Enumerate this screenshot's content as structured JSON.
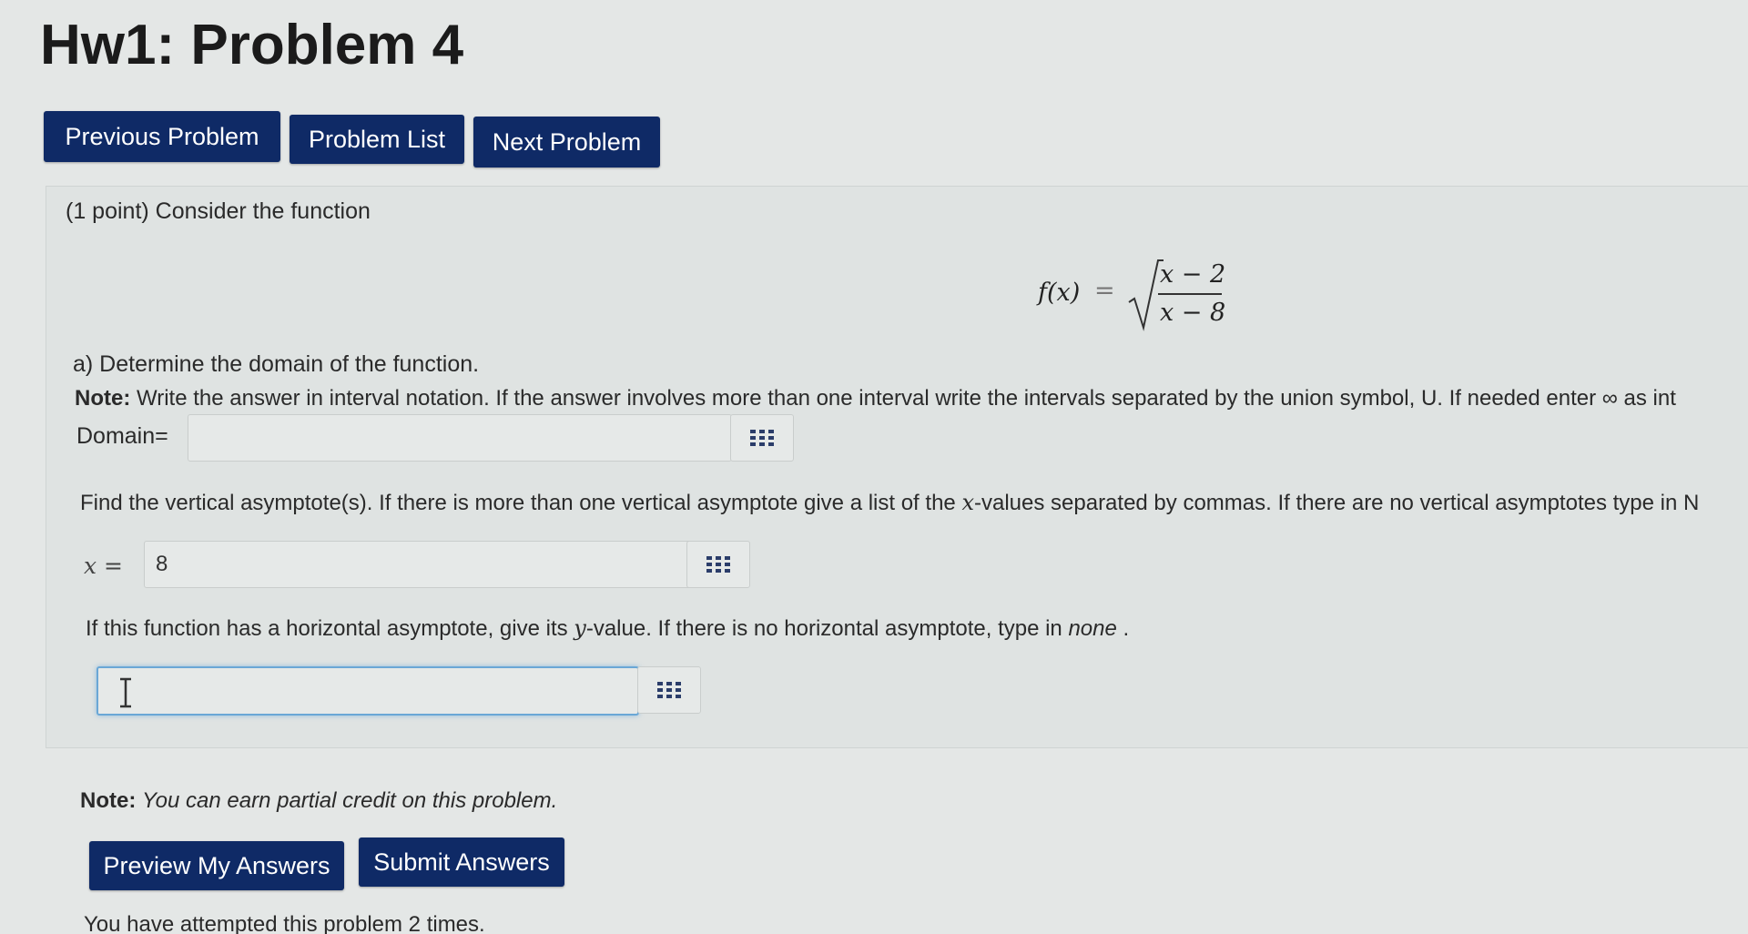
{
  "page": {
    "title": "Hw1: Problem 4"
  },
  "nav": {
    "previous": "Previous Problem",
    "list": "Problem List",
    "next": "Next Problem"
  },
  "problem": {
    "intro": "(1 point) Consider the function",
    "formula": {
      "lhs": "f(x)",
      "eq": "=",
      "numerator": "x − 2",
      "denominator": "x − 8"
    },
    "part_a": "a) Determine the domain of the function.",
    "note_label": "Note:",
    "note_text": " Write the answer in interval notation. If the answer involves more than one interval write the intervals separated by the union symbol, U. If needed enter ∞ as int",
    "domain_label": "Domain=",
    "domain_value": "",
    "vertical_text_1": "Find the vertical asymptote(s). If there is more than one vertical asymptote give a list of the ",
    "vertical_var": "x",
    "vertical_text_2": "-values separated by commas. If there are no vertical asymptotes type in N",
    "x_label": "x =",
    "x_value": "8",
    "horizontal_text_1": "If this function has a horizontal asymptote, give its ",
    "horizontal_var": "y",
    "horizontal_text_2": "-value. If there is no horizontal asymptote, type in ",
    "horizontal_none": "none",
    "horizontal_end": " .",
    "horizontal_value": ""
  },
  "footer": {
    "note_label": "Note:",
    "note_text": "You can earn partial credit on this problem.",
    "preview_button": "Preview My Answers",
    "submit_button": "Submit Answers",
    "attempts": "You have attempted this problem 2 times."
  },
  "icons": {
    "equation_editor": "grid-icon",
    "text_cursor": "text-cursor-icon"
  },
  "colors": {
    "button_bg": "#0f2a66",
    "page_bg": "#e4e7e6"
  }
}
